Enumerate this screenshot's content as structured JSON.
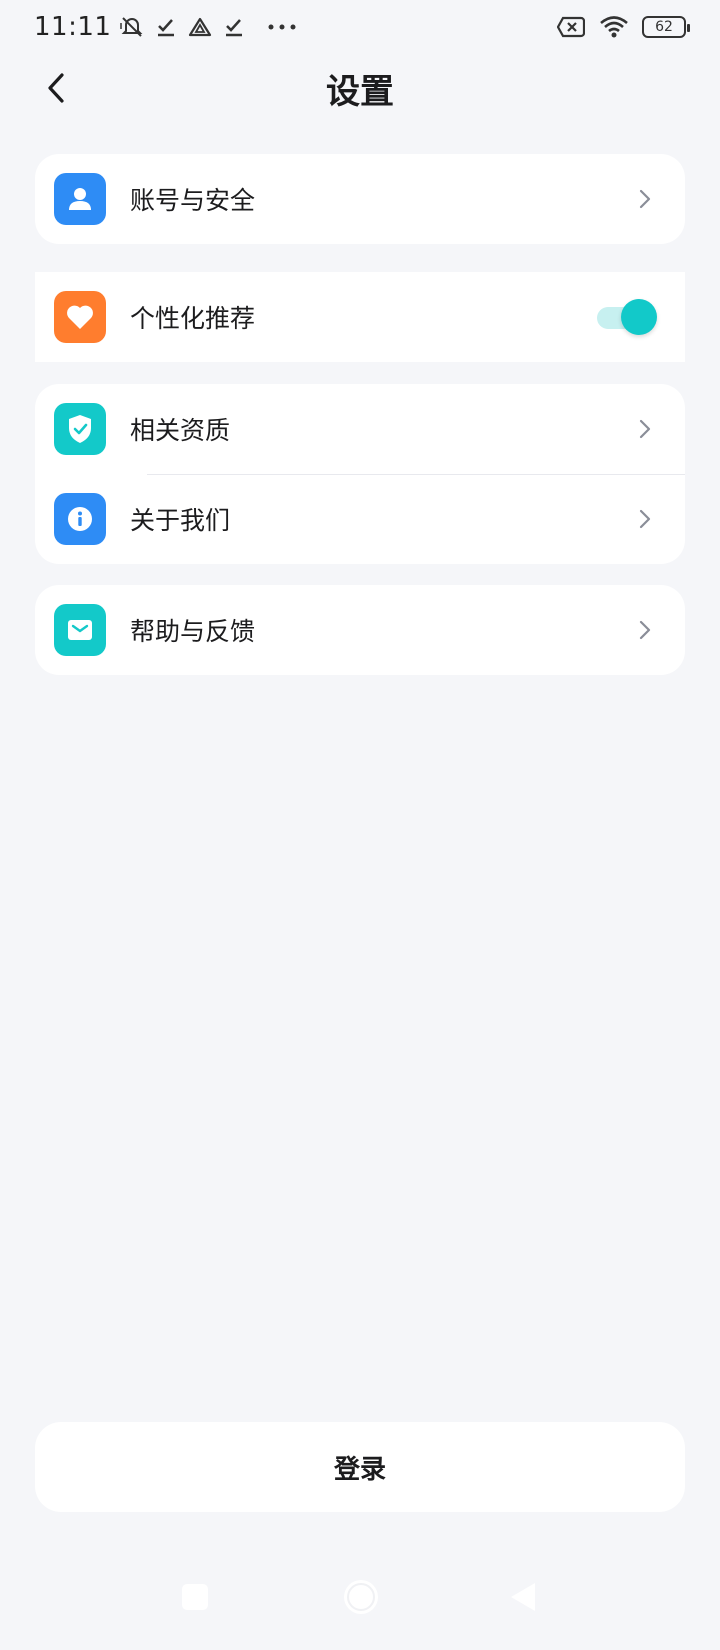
{
  "status_bar": {
    "time": "11:11",
    "battery": "62",
    "icons": [
      "mute-icon",
      "check-icon",
      "drive-icon",
      "check-icon",
      "more-dots-icon",
      "data-off-icon",
      "wifi-icon",
      "battery-icon"
    ]
  },
  "header": {
    "title": "设置"
  },
  "sections": {
    "account": {
      "label": "账号与安全",
      "icon": "person-icon",
      "color": "#2e8cf5"
    },
    "personalize": {
      "label": "个性化推荐",
      "icon": "heart-icon",
      "color": "#ff7d2e",
      "enabled": true
    },
    "qualification": {
      "label": "相关资质",
      "icon": "shield-check-icon",
      "color": "#13c9c9"
    },
    "about": {
      "label": "关于我们",
      "icon": "info-icon",
      "color": "#2e8cf5"
    },
    "help": {
      "label": "帮助与反馈",
      "icon": "mail-icon",
      "color": "#13c9c9"
    }
  },
  "login": {
    "label": "登录"
  },
  "colors": {
    "accent": "#12c9c9",
    "background": "#f5f6f9"
  }
}
